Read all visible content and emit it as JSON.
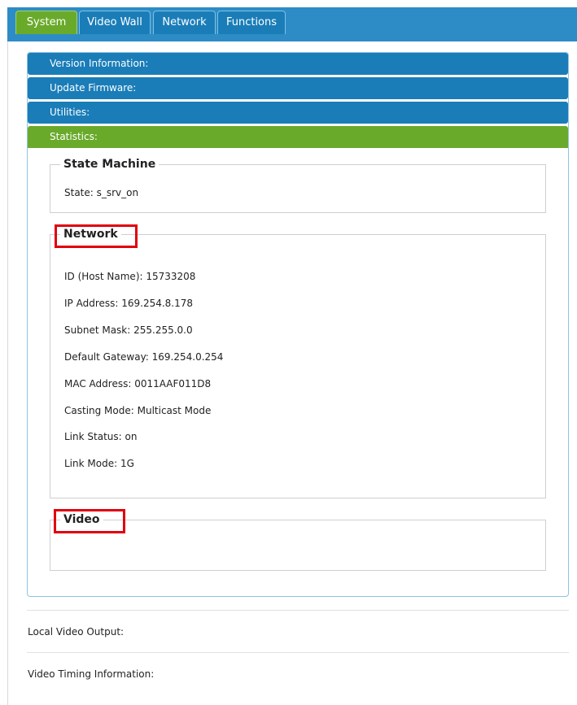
{
  "tabs": {
    "system": "System",
    "video_wall": "Video Wall",
    "network": "Network",
    "functions": "Functions"
  },
  "accordion": {
    "version_information": "Version Information:",
    "update_firmware": "Update Firmware:",
    "utilities": "Utilities:",
    "statistics": "Statistics:"
  },
  "state_machine": {
    "title": "State Machine",
    "state": "State: s_srv_on"
  },
  "network": {
    "title": "Network",
    "lines": [
      "ID (Host Name): 15733208",
      "IP Address: 169.254.8.178",
      "Subnet Mask: 255.255.0.0",
      "Default Gateway: 169.254.0.254",
      "MAC Address: 0011AAF011D8",
      "Casting Mode: Multicast Mode",
      "Link Status: on",
      "Link Mode: 1G"
    ]
  },
  "video": {
    "title": "Video"
  },
  "bottom": {
    "local_video_output": "Local Video Output:",
    "video_timing_information": "Video Timing Information:"
  },
  "colors": {
    "tab_bar": "#2d8cc6",
    "tab_blue": "#1a7db8",
    "active_green": "#6aaa2b",
    "highlight_red": "#e0000f"
  }
}
